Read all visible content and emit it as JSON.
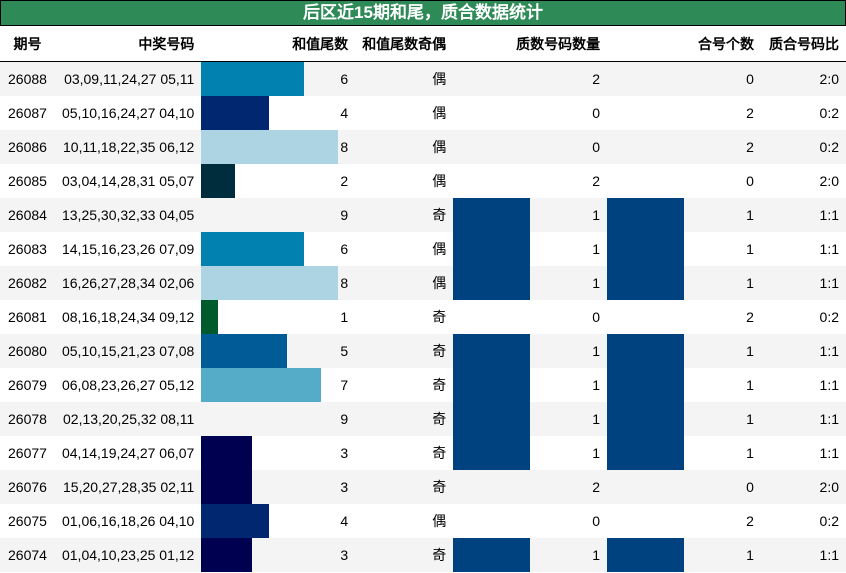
{
  "title": "后区近15期和尾，质合数据统计",
  "headers": [
    "期号",
    "中奖号码",
    "和值尾数",
    "和值尾数奇偶",
    "质数号码数量",
    "合号个数",
    "质合号码比"
  ],
  "colors": {
    "header_bg": "#2e8b57",
    "block_blue": "#00427f"
  },
  "rows": [
    {
      "period": "26088",
      "numbers": "03,09,11,24,27 05,11",
      "tail": "6",
      "parity": "偶",
      "prime": "2",
      "composite": "0",
      "ratio": "2:0"
    },
    {
      "period": "26087",
      "numbers": "05,10,16,24,27 04,10",
      "tail": "4",
      "parity": "偶",
      "prime": "0",
      "composite": "2",
      "ratio": "0:2"
    },
    {
      "period": "26086",
      "numbers": "10,11,18,22,35 06,12",
      "tail": "8",
      "parity": "偶",
      "prime": "0",
      "composite": "2",
      "ratio": "0:2"
    },
    {
      "period": "26085",
      "numbers": "03,04,14,28,31 05,07",
      "tail": "2",
      "parity": "偶",
      "prime": "2",
      "composite": "0",
      "ratio": "2:0"
    },
    {
      "period": "26084",
      "numbers": "13,25,30,32,33 04,05",
      "tail": "9",
      "parity": "奇",
      "prime": "1",
      "composite": "1",
      "ratio": "1:1"
    },
    {
      "period": "26083",
      "numbers": "14,15,16,23,26 07,09",
      "tail": "6",
      "parity": "偶",
      "prime": "1",
      "composite": "1",
      "ratio": "1:1"
    },
    {
      "period": "26082",
      "numbers": "16,26,27,28,34 02,06",
      "tail": "8",
      "parity": "偶",
      "prime": "1",
      "composite": "1",
      "ratio": "1:1"
    },
    {
      "period": "26081",
      "numbers": "08,16,18,24,34 09,12",
      "tail": "1",
      "parity": "奇",
      "prime": "0",
      "composite": "2",
      "ratio": "0:2"
    },
    {
      "period": "26080",
      "numbers": "05,10,15,21,23 07,08",
      "tail": "5",
      "parity": "奇",
      "prime": "1",
      "composite": "1",
      "ratio": "1:1"
    },
    {
      "period": "26079",
      "numbers": "06,08,23,26,27 05,12",
      "tail": "7",
      "parity": "奇",
      "prime": "1",
      "composite": "1",
      "ratio": "1:1"
    },
    {
      "period": "26078",
      "numbers": "02,13,20,25,32 08,11",
      "tail": "9",
      "parity": "奇",
      "prime": "1",
      "composite": "1",
      "ratio": "1:1"
    },
    {
      "period": "26077",
      "numbers": "04,14,19,24,27 06,07",
      "tail": "3",
      "parity": "奇",
      "prime": "1",
      "composite": "1",
      "ratio": "1:1"
    },
    {
      "period": "26076",
      "numbers": "15,20,27,28,35 02,11",
      "tail": "3",
      "parity": "奇",
      "prime": "2",
      "composite": "0",
      "ratio": "2:0"
    },
    {
      "period": "26075",
      "numbers": "01,06,16,18,26 04,10",
      "tail": "4",
      "parity": "偶",
      "prime": "0",
      "composite": "2",
      "ratio": "0:2"
    },
    {
      "period": "26074",
      "numbers": "01,04,10,23,25 01,12",
      "tail": "3",
      "parity": "奇",
      "prime": "1",
      "composite": "1",
      "ratio": "1:1"
    }
  ]
}
